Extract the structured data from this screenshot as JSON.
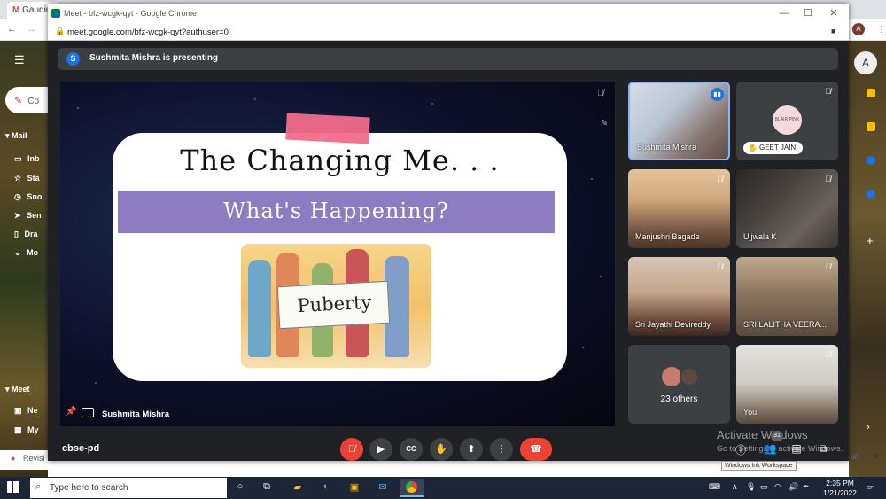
{
  "background_browser": {
    "tab_label": "Gaudiu",
    "sidebar": {
      "compose_abbrev": "Co",
      "mail_header": "Mail",
      "items": [
        "Inb",
        "Sta",
        "Sno",
        "Sen",
        "Dra",
        "Mo"
      ],
      "meet_header": "Meet",
      "meet_items": [
        "Ne",
        "My"
      ]
    },
    "bottom_tab": "Revisi",
    "avatar_letter": "A"
  },
  "window": {
    "title": "Meet - bfz-wcgk-qyt - Google Chrome",
    "url": "meet.google.com/bfz-wcgk-qyt?authuser=0",
    "avatar_letter": "A"
  },
  "presenting_banner": {
    "avatar_letter": "S",
    "text": "Sushmita Mishra is presenting"
  },
  "slide": {
    "title": "The Changing Me. . .",
    "subtitle": "What's Happening?",
    "sign_text": "Puberty",
    "presenter_label": "Sushmita Mishra"
  },
  "participants": [
    {
      "name": "Sushmita Mishra",
      "speaking": true
    },
    {
      "name": "GEET JAIN",
      "muted": true,
      "hand_raised": true,
      "logo_text": "BLAIR PINK"
    },
    {
      "name": "Manjushri Bagade",
      "muted": true
    },
    {
      "name": "Ujjwala K",
      "muted": true
    },
    {
      "name": "Sri Jayathi Devireddy",
      "muted": true
    },
    {
      "name": "SRI LALITHA VEERA...",
      "muted": true
    },
    {
      "name": "23 others"
    },
    {
      "name": "You",
      "muted": true
    }
  ],
  "meeting_code": "cbse-pd",
  "controls": [
    "mic-off",
    "camera",
    "captions",
    "raise-hand",
    "present",
    "more",
    "end-call"
  ],
  "right_controls": {
    "people_count": "31"
  },
  "activation": {
    "title": "Activate Windows",
    "body": "Go to Settings to activate Windows.",
    "tooltip": "Windows Ink Workspace"
  },
  "taskbar": {
    "search_placeholder": "Type here to search",
    "time": "2:35 PM",
    "date": "1/21/2022"
  },
  "colors": {
    "accent": "#1a73e8",
    "danger": "#ea4335",
    "slide_band": "#8e7cc3",
    "tape": "#f26b8a"
  }
}
